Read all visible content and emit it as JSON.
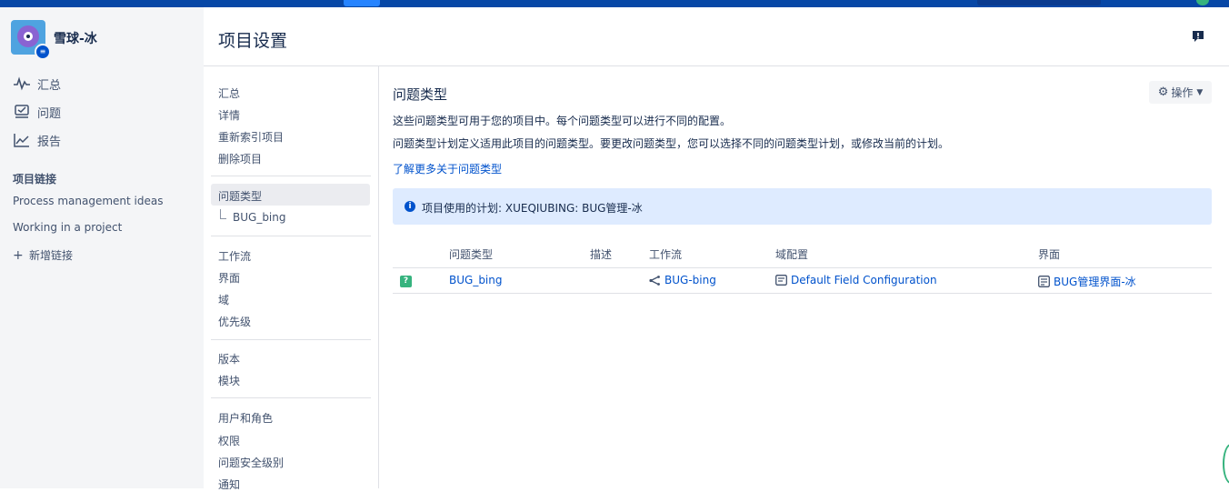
{
  "project": {
    "name": "雪球-冰"
  },
  "sidebar": {
    "items": [
      {
        "label": "汇总",
        "icon": "pulse-icon"
      },
      {
        "label": "问题",
        "icon": "issues-icon"
      },
      {
        "label": "报告",
        "icon": "chart-icon"
      }
    ],
    "links_heading": "项目链接",
    "links": [
      "Process management ideas",
      "Working in a project"
    ],
    "add_link": "新增链接"
  },
  "header": {
    "title": "项目设置"
  },
  "settings_nav": {
    "group1": [
      "汇总",
      "详情",
      "重新索引项目",
      "删除项目"
    ],
    "selected": "问题类型",
    "sub_item": "BUG_bing",
    "group2": [
      "工作流",
      "界面",
      "域",
      "优先级"
    ],
    "group3": [
      "版本",
      "模块"
    ],
    "group4": [
      "用户和角色",
      "权限",
      "问题安全级别",
      "通知"
    ]
  },
  "main": {
    "title": "问题类型",
    "actions_label": "操作",
    "desc1": "这些问题类型可用于您的项目中。每个问题类型可以进行不同的配置。",
    "desc2": "问题类型计划定义适用此项目的问题类型。要更改问题类型，您可以选择不同的问题类型计划，或修改当前的计划。",
    "learn_more": "了解更多关于问题类型",
    "info": "项目使用的计划: XUEQIUBING: BUG管理-冰",
    "table": {
      "headers": [
        "问题类型",
        "描述",
        "工作流",
        "域配置",
        "界面"
      ],
      "rows": [
        {
          "issue_type": "BUG_bing",
          "description": "",
          "workflow": "BUG-bing",
          "field_config": "Default Field Configuration",
          "screen": "BUG管理界面-冰"
        }
      ]
    }
  },
  "colors": {
    "primary": "#0052cc",
    "topbar": "#0747a6",
    "info_bg": "#deebff",
    "sidebar_bg": "#f4f5f7"
  }
}
